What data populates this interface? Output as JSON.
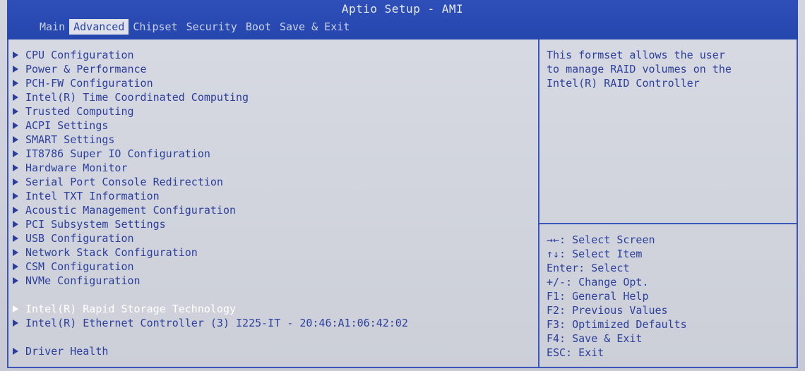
{
  "header": {
    "title": "Aptio Setup - AMI",
    "tabs": [
      {
        "label": "Main"
      },
      {
        "label": "Advanced",
        "active": true
      },
      {
        "label": "Chipset"
      },
      {
        "label": "Security"
      },
      {
        "label": "Boot"
      },
      {
        "label": "Save & Exit"
      }
    ]
  },
  "menu": {
    "items": [
      {
        "label": "CPU Configuration"
      },
      {
        "label": "Power & Performance"
      },
      {
        "label": "PCH-FW Configuration"
      },
      {
        "label": "Intel(R) Time Coordinated Computing"
      },
      {
        "label": "Trusted Computing"
      },
      {
        "label": "ACPI Settings"
      },
      {
        "label": "SMART Settings"
      },
      {
        "label": "IT8786 Super IO Configuration"
      },
      {
        "label": "Hardware Monitor"
      },
      {
        "label": "Serial Port Console Redirection"
      },
      {
        "label": "Intel TXT Information"
      },
      {
        "label": "Acoustic Management Configuration"
      },
      {
        "label": "PCI Subsystem Settings"
      },
      {
        "label": "USB Configuration"
      },
      {
        "label": "Network Stack Configuration"
      },
      {
        "label": "CSM Configuration"
      },
      {
        "label": "NVMe Configuration"
      },
      {
        "label": "Intel(R) Rapid Storage Technology",
        "selected": true
      },
      {
        "label": "Intel(R) Ethernet Controller (3) I225-IT - 20:46:A1:06:42:02"
      },
      {
        "label": "Driver Health"
      }
    ]
  },
  "help": {
    "lines": [
      "This formset allows the user",
      "to manage RAID volumes on the",
      "Intel(R) RAID Controller"
    ]
  },
  "keys": {
    "lines": [
      "→←: Select Screen",
      "↑↓: Select Item",
      "Enter: Select",
      "+/-: Change Opt.",
      "F1: General Help",
      "F2: Previous Values",
      "F3: Optimized Defaults",
      "F4: Save & Exit",
      "ESC: Exit"
    ]
  },
  "colors": {
    "header_bg": "#2546ad",
    "text": "#2c3f9c",
    "selected_text": "#ffffff",
    "active_tab_bg": "#dfe2ea"
  }
}
